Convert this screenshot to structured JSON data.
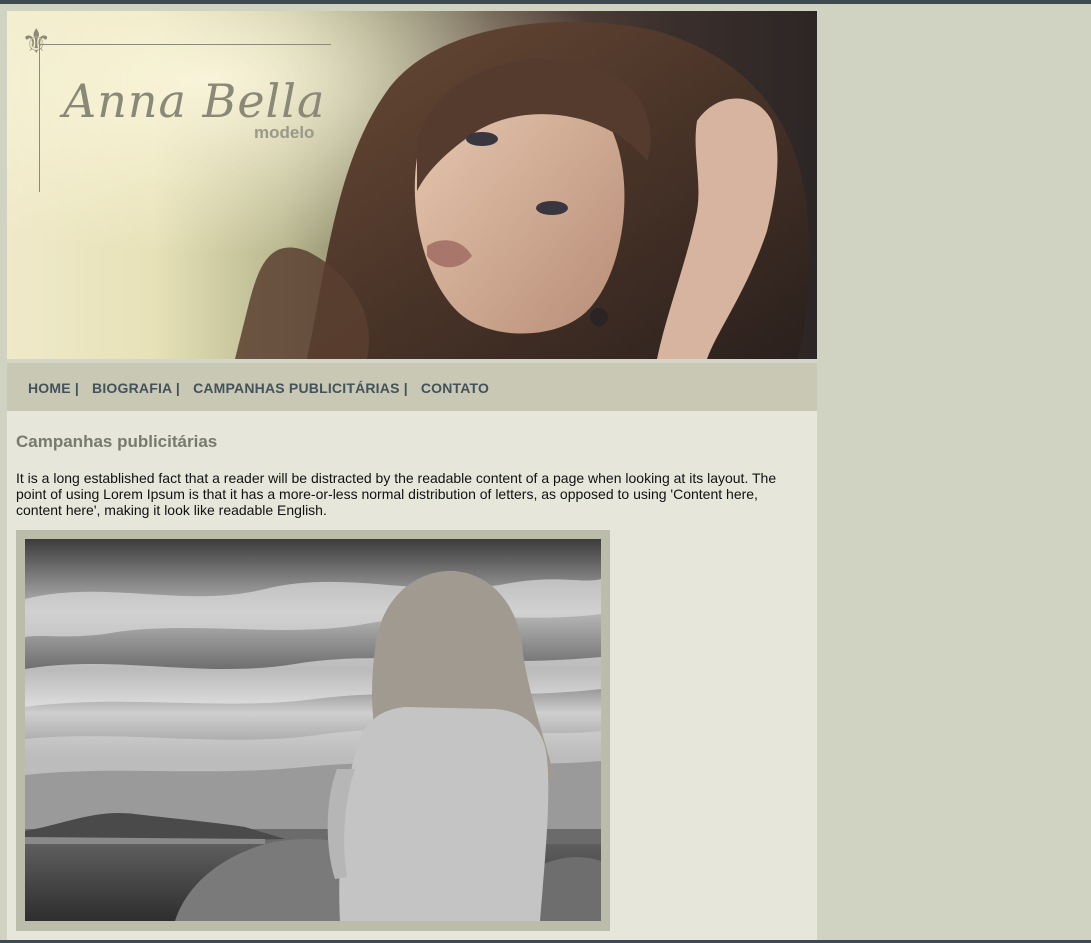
{
  "site": {
    "title": "Anna Bella",
    "subtitle": "modelo",
    "ornament": "⚜"
  },
  "nav": {
    "items": [
      {
        "label": "HOME |"
      },
      {
        "label": "BIOGRAFIA |"
      },
      {
        "label": "CAMPANHAS PUBLICITÁRIAS |"
      },
      {
        "label": "CONTATO"
      }
    ]
  },
  "main": {
    "title": "Campanhas publicitárias",
    "text": "It is a long established fact that a reader will be distracted by the readable content of a page when looking at its layout. The point of using Lorem Ipsum is that it has a more-or-less normal distribution of letters, as opposed to using 'Content here, content here', making it look like readable English."
  },
  "colors": {
    "background": "#d1d3c2",
    "page": "#e6e7da",
    "nav_bar": "#c8c8b4",
    "nav_text": "#44525a",
    "title_text": "#777a6c",
    "top_strip": "#3d4a52"
  }
}
